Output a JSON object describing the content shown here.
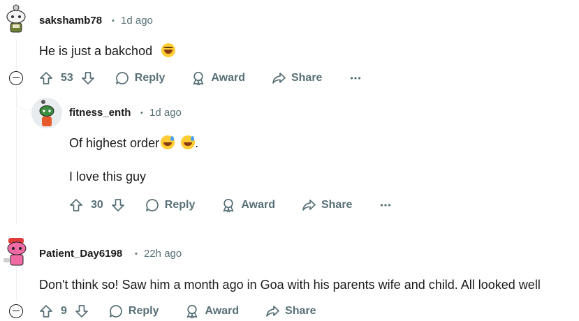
{
  "comments": [
    {
      "username": "sakshamb78",
      "time": "1d ago",
      "text": "He is just a bakchod",
      "votes": "53",
      "reply_label": "Reply",
      "award_label": "Award",
      "share_label": "Share"
    },
    {
      "username": "fitness_enth",
      "time": "1d ago",
      "text_line1": "Of highest order",
      "text_line1_tail": ".",
      "text_line2": "I love this guy",
      "votes": "30",
      "reply_label": "Reply",
      "award_label": "Award",
      "share_label": "Share"
    },
    {
      "username": "Patient_Day6198",
      "time": "22h ago",
      "text": "Don't think so! Saw him a month ago in Goa with his parents wife and child. All looked well",
      "votes": "9",
      "reply_label": "Reply",
      "award_label": "Award",
      "share_label": "Share"
    }
  ],
  "separator": "•",
  "icons": {
    "upvote": "upvote-arrow-icon",
    "downvote": "downvote-arrow-icon",
    "reply": "speech-bubble-icon",
    "award": "award-ribbon-icon",
    "share": "share-arrow-icon",
    "more": "more-horizontal-icon",
    "collapse": "collapse-minus-icon"
  },
  "colors": {
    "meta": "#576f76",
    "text": "#1a1a1b",
    "thread_line": "#edeff1"
  }
}
